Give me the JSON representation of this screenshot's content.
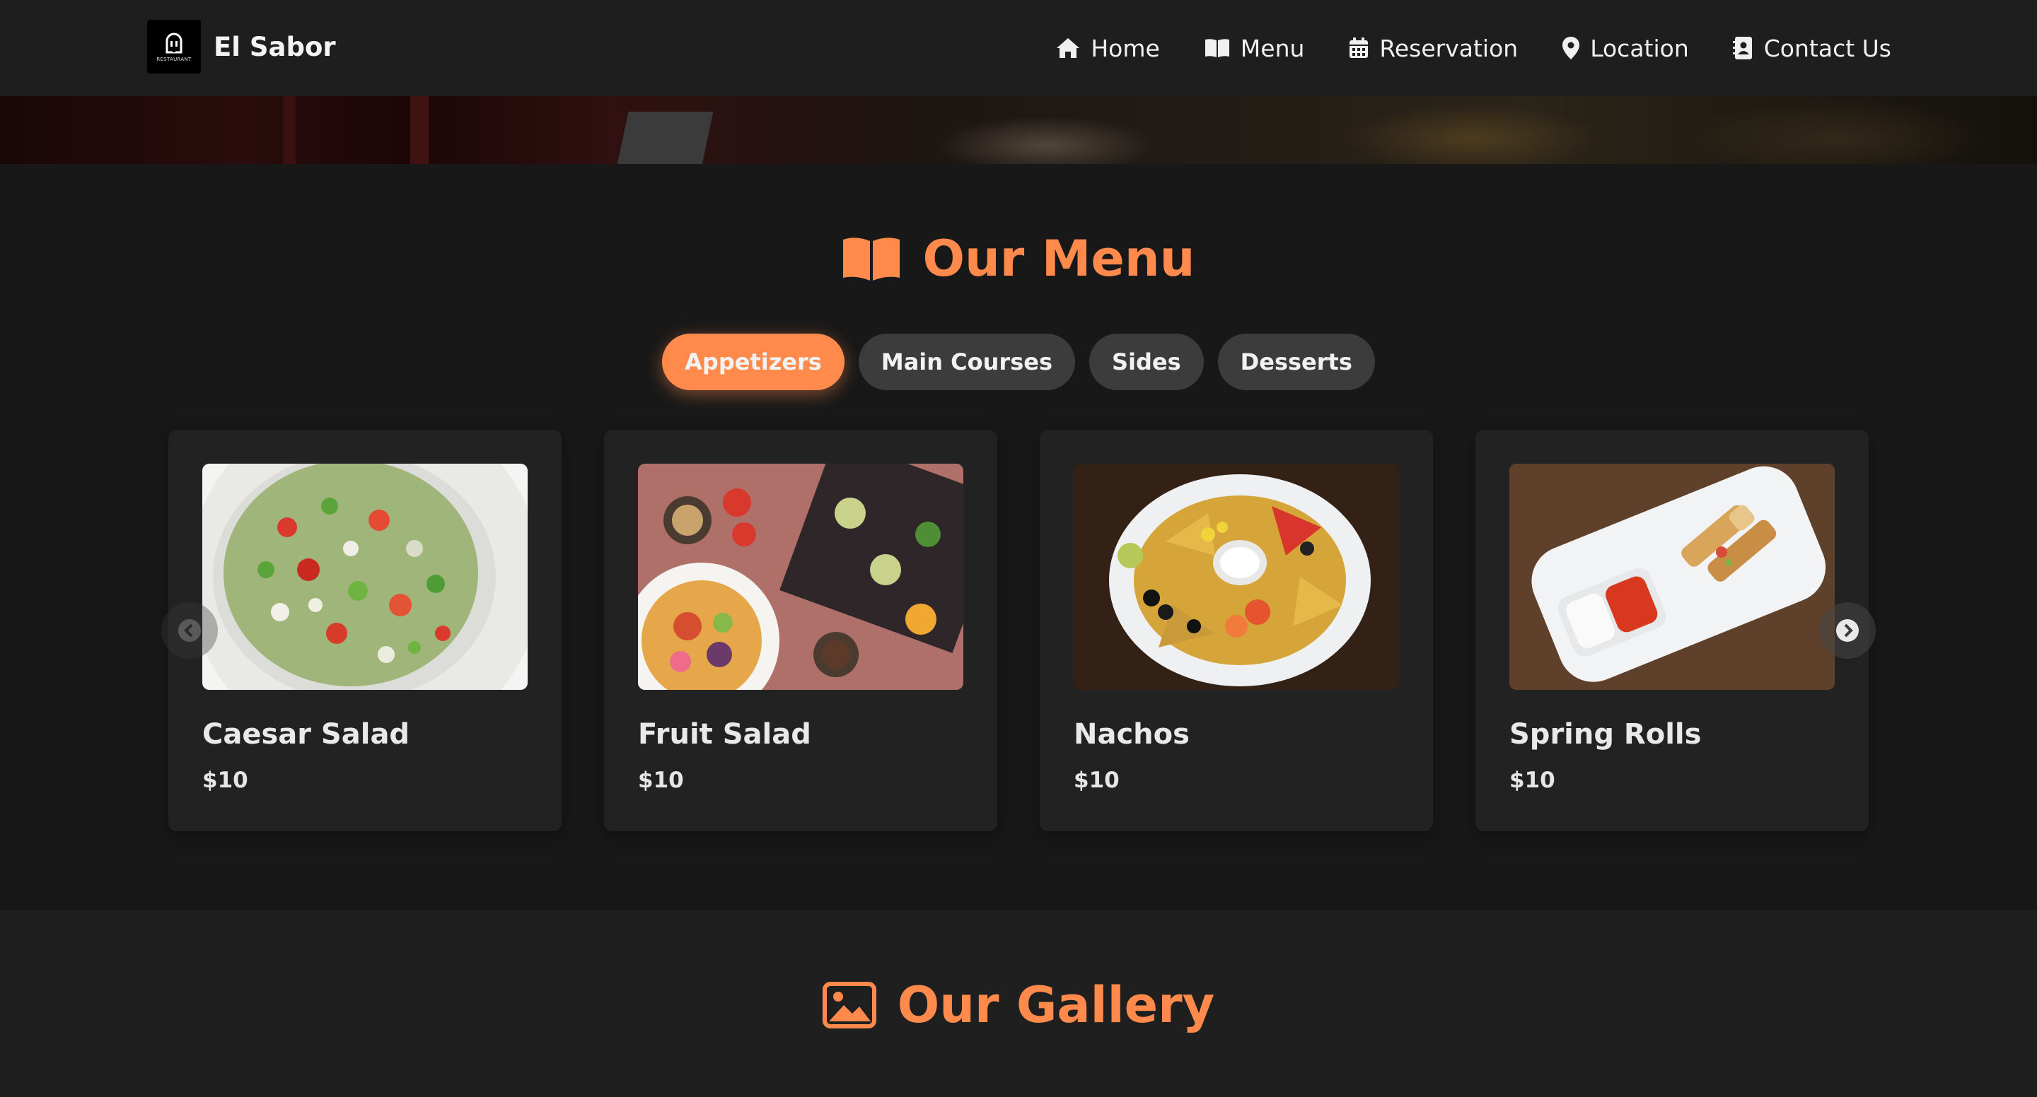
{
  "brand": {
    "name": "El Sabor",
    "logo_text": "RESTAURANT",
    "logo_icon": "chef-helmet-icon"
  },
  "nav": {
    "items": [
      {
        "label": "Home",
        "icon": "home-icon"
      },
      {
        "label": "Menu",
        "icon": "book-open-icon"
      },
      {
        "label": "Reservation",
        "icon": "calendar-icon"
      },
      {
        "label": "Location",
        "icon": "map-pin-icon"
      },
      {
        "label": "Contact Us",
        "icon": "contact-book-icon"
      }
    ]
  },
  "menu": {
    "title": "Our Menu",
    "title_icon": "book-open-icon",
    "tabs": [
      {
        "label": "Appetizers",
        "active": true
      },
      {
        "label": "Main Courses",
        "active": false
      },
      {
        "label": "Sides",
        "active": false
      },
      {
        "label": "Desserts",
        "active": false
      }
    ],
    "items": [
      {
        "name": "Caesar Salad",
        "price": "$10"
      },
      {
        "name": "Fruit Salad",
        "price": "$10"
      },
      {
        "name": "Nachos",
        "price": "$10"
      },
      {
        "name": "Spring Rolls",
        "price": "$10"
      }
    ]
  },
  "gallery": {
    "title": "Our Gallery",
    "title_icon": "image-icon"
  },
  "colors": {
    "accent": "#ff8a4c",
    "background": "#181818",
    "navbar": "#1e1e1e",
    "card": "#222222",
    "tab_inactive": "#3c3c3c"
  }
}
